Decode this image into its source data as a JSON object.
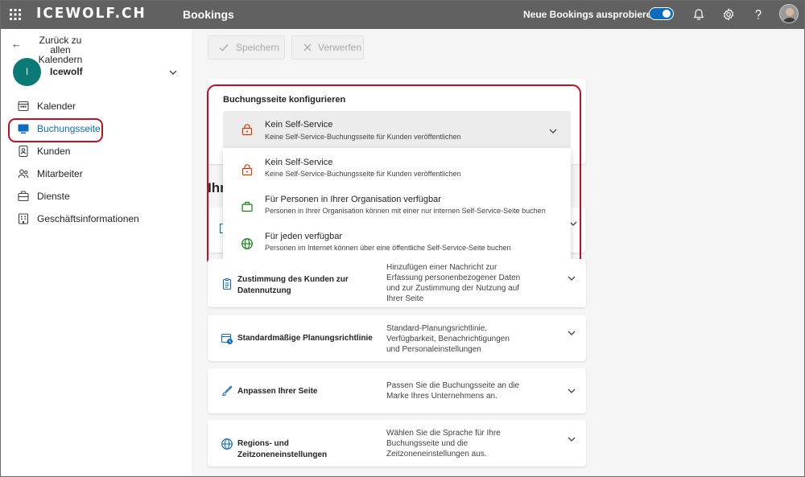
{
  "topbar": {
    "brand": "ICEWOLF.CH",
    "app_name": "Bookings",
    "try_new_label": "Neue Bookings ausprobieren",
    "toggle_on": true,
    "accent": "#0f6cbd",
    "bar_color": "#616161"
  },
  "leftnav": {
    "back_label": "Zurück zu allen Kalendern",
    "calendar": {
      "initial": "I",
      "name": "Icewolf",
      "color": "#0b7a75"
    },
    "items": [
      {
        "label": "Kalender",
        "icon": "calendar-icon",
        "active": false
      },
      {
        "label": "Buchungsseite",
        "icon": "monitor-icon",
        "active": true
      },
      {
        "label": "Kunden",
        "icon": "contact-card-icon",
        "active": false
      },
      {
        "label": "Mitarbeiter",
        "icon": "people-icon",
        "active": false
      },
      {
        "label": "Dienste",
        "icon": "briefcase-icon",
        "active": false
      },
      {
        "label": "Geschäftsinformationen",
        "icon": "building-icon",
        "active": false
      }
    ]
  },
  "toolbar": {
    "save_label": "Speichern",
    "discard_label": "Verwerfen"
  },
  "config": {
    "title": "Buchungsseite konfigurieren",
    "selected": {
      "title": "Kein Self-Service",
      "subtitle": "Keine Self-Service-Buchungsseite für Kunden veröffentlichen",
      "icon": "lock-icon"
    },
    "options": [
      {
        "title": "Kein Self-Service",
        "subtitle": "Keine Self-Service-Buchungsseite für Kunden veröffentlichen",
        "icon": "lock-icon",
        "color": "#d83b01"
      },
      {
        "title": "Für Personen in Ihrer Organisation verfügbar",
        "subtitle": "Personen in Ihrer Organisation können mit einer nur internen Self-Service-Seite buchen",
        "icon": "briefcase-icon",
        "color": "#107c10"
      },
      {
        "title": "Für jeden verfügbar",
        "subtitle": "Personen im Internet können über eine öffentliche Self-Service-Seite buchen",
        "icon": "globe-icon",
        "color": "#107c10"
      }
    ]
  },
  "behind_heading": "Ihr",
  "sections": [
    {
      "title": "Zustimmung des Kunden zur Datennutzung",
      "description": "Hinzufügen einer Nachricht zur Erfassung personenbezogener Daten und zur Zustimmung der Nutzung auf Ihrer Seite",
      "icon": "consent-icon"
    },
    {
      "title": "Standardmäßige Planungsrichtlinie",
      "description": "Standard-Planungsrichtlinie, Verfügbarkeit, Benachrichtigungen und Personaleinstellungen",
      "icon": "calendar-clock-icon"
    },
    {
      "title": "Anpassen Ihrer Seite",
      "description": "Passen Sie die Buchungsseite an die Marke Ihres Unternehmens an.",
      "icon": "paint-brush-icon"
    },
    {
      "title": "Regions- und Zeitzoneneinstellungen",
      "description": "Wählen Sie die Sprache für Ihre Buchungsseite und die Zeitzoneneinstellungen aus.",
      "icon": "globe-icon"
    }
  ]
}
